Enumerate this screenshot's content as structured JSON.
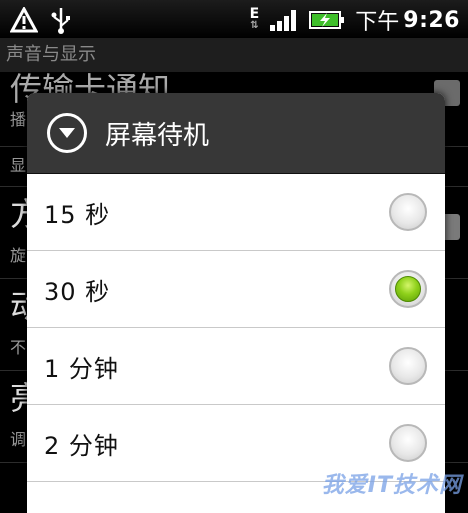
{
  "status_bar": {
    "network_type": "E",
    "time_period": "下午",
    "time": "9:26",
    "icons": [
      "warning-icon",
      "usb-icon",
      "data-arrows-icon",
      "signal-icon",
      "battery-charging-icon"
    ]
  },
  "background": {
    "page_title": "声音与显示",
    "rows": [
      {
        "big": "",
        "small": ""
      },
      {
        "big": "",
        "small": "显"
      },
      {
        "big": "方",
        "small": "旋"
      },
      {
        "big": "动",
        "small": "不"
      },
      {
        "big": "亮",
        "small": "调"
      }
    ],
    "partial_heading": "传输卡通知",
    "partial_sub": "播"
  },
  "dialog": {
    "title": "屏幕待机",
    "options": [
      {
        "label": "15 秒",
        "selected": false
      },
      {
        "label": "30 秒",
        "selected": true
      },
      {
        "label": "1 分钟",
        "selected": false
      },
      {
        "label": "2 分钟",
        "selected": false
      }
    ]
  },
  "watermark": "我爱IT技术网",
  "colors": {
    "accent_green": "#8fd11b",
    "dialog_header": "#373737",
    "background": "#000000"
  }
}
